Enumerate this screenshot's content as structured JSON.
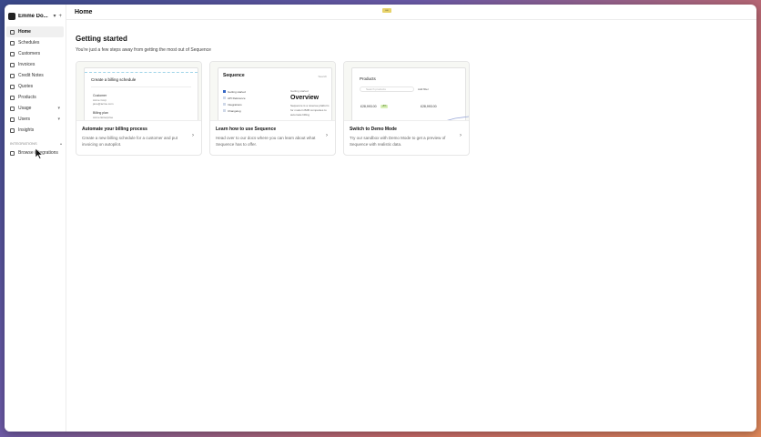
{
  "workspace": {
    "name": "Emme Do...",
    "chevron": "▾",
    "plus": "+"
  },
  "sidebar": {
    "items": [
      {
        "label": "Home",
        "icon": "home-icon",
        "active": true
      },
      {
        "label": "Schedules",
        "icon": "calendar-icon"
      },
      {
        "label": "Customers",
        "icon": "users-icon"
      },
      {
        "label": "Invoices",
        "icon": "invoice-icon"
      },
      {
        "label": "Credit Notes",
        "icon": "credit-note-icon"
      },
      {
        "label": "Quotes",
        "icon": "quote-icon"
      },
      {
        "label": "Products",
        "icon": "box-icon"
      },
      {
        "label": "Usage",
        "icon": "usage-icon",
        "chevron": "▾"
      },
      {
        "label": "Users",
        "icon": "user-icon",
        "chevron": "▾"
      },
      {
        "label": "Insights",
        "icon": "chart-icon"
      }
    ],
    "section": {
      "label": "INTEGRATIONS",
      "chevron": "▴"
    },
    "integration_item": {
      "label": "Browse integrations",
      "icon": "grid-icon"
    }
  },
  "topbar": {
    "title": "Home",
    "badge": "•••"
  },
  "main": {
    "heading": "Getting started",
    "subheading": "You're just a few steps away from getting the most out of Sequence",
    "cards": [
      {
        "title": "Automate your billing process",
        "description": "Create a new billing schedule for a customer and put invoicing on autopilot.",
        "arrow": "›",
        "preview": {
          "title": "Create a billing schedule",
          "customer_label": "Customer",
          "customer_value": "Acme Corp",
          "customer_email": "jane@acme.com",
          "billing_label": "Billing plan",
          "billing_value": "Acme Enterprise"
        }
      },
      {
        "title": "Learn how to use Sequence",
        "description": "Head over to our docs where you can learn about what Sequence has to offer.",
        "arrow": "›",
        "preview": {
          "logo": "Sequence",
          "search": "Search",
          "nav": [
            "Getting started",
            "API Reference",
            "Integrations",
            "Changelog"
          ],
          "crumb": "Getting started",
          "heading": "Overview",
          "text": "Sequence is a revenue platform for modern B2B companies to automate billing"
        }
      },
      {
        "title": "Switch to Demo Mode",
        "description": "Try our sandbox with Demo Mode to get a preview of Sequence with realistic data.",
        "arrow": "›",
        "preview": {
          "title": "Products",
          "search": "Search products",
          "filter": "Add filter",
          "amount1": "£28,993.00",
          "badge": "+8%",
          "amount2": "£28,993.00"
        }
      }
    ]
  }
}
